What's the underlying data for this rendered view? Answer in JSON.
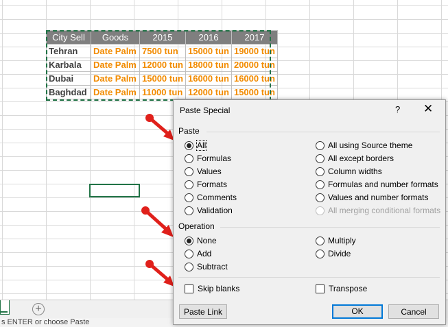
{
  "sheet": {
    "headers": [
      "City Sell",
      "Goods",
      "2015",
      "2016",
      "2017"
    ],
    "rows": [
      [
        "Tehran",
        "Date Palm",
        "7500 tun",
        "15000 tun",
        "19000 tun"
      ],
      [
        "Karbala",
        "Date Palm",
        "12000 tun",
        "18000 tun",
        "20000 tun"
      ],
      [
        "Dubai",
        "Date Palm",
        "15000 tun",
        "16000 tun",
        "16000 tun"
      ],
      [
        "Baghdad",
        "Date Palm",
        "11000 tun",
        "12000 tun",
        "15000 tun"
      ]
    ],
    "add_sheet_glyph": "+",
    "status_text": "s ENTER or choose Paste"
  },
  "dialog": {
    "title": "Paste Special",
    "help": "?",
    "close": "✕",
    "paste_section": "Paste",
    "paste_left": [
      "All",
      "Formulas",
      "Values",
      "Formats",
      "Comments",
      "Validation"
    ],
    "paste_right": [
      "All using Source theme",
      "All except borders",
      "Column widths",
      "Formulas and number formats",
      "Values and number formats",
      "All merging conditional formats"
    ],
    "operation_section": "Operation",
    "operation_left": [
      "None",
      "Add",
      "Subtract"
    ],
    "operation_right": [
      "Multiply",
      "Divide"
    ],
    "skip_blanks": "Skip blanks",
    "transpose": "Transpose",
    "paste_link": "Paste Link",
    "ok": "OK",
    "cancel": "Cancel"
  },
  "colors": {
    "accent": "#217346",
    "orange": "#f28b00",
    "arrow": "#e0201b",
    "header_bg": "#7f7f7f"
  }
}
